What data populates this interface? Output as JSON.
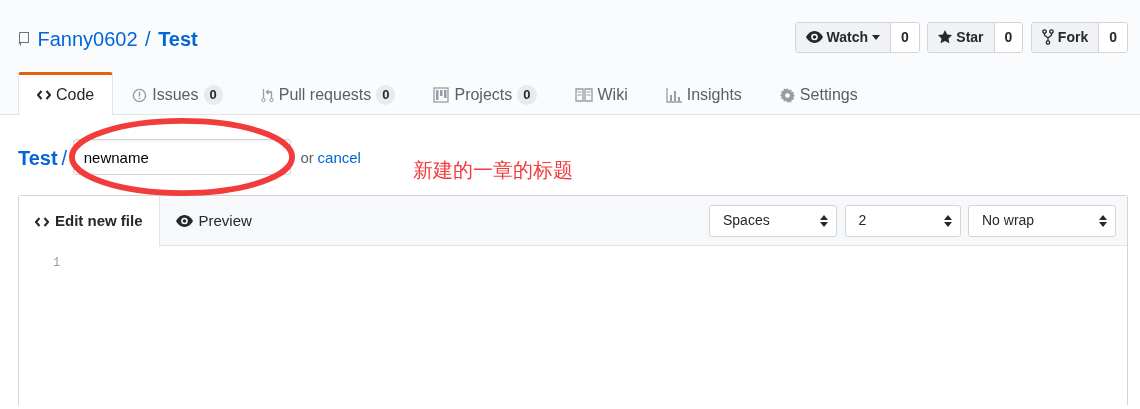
{
  "repo": {
    "owner": "Fanny0602",
    "separator": "/",
    "name": "Test"
  },
  "actions": [
    {
      "kind": "watch",
      "label": "Watch",
      "count": "0"
    },
    {
      "kind": "star",
      "label": "Star",
      "count": "0"
    },
    {
      "kind": "fork",
      "label": "Fork",
      "count": "0"
    }
  ],
  "tabs": [
    {
      "kind": "code",
      "label": "Code",
      "selected": true
    },
    {
      "kind": "issues",
      "label": "Issues",
      "count": "0",
      "selected": false
    },
    {
      "kind": "pulls",
      "label": "Pull requests",
      "count": "0",
      "selected": false
    },
    {
      "kind": "projects",
      "label": "Projects",
      "count": "0",
      "selected": false
    },
    {
      "kind": "wiki",
      "label": "Wiki",
      "selected": false
    },
    {
      "kind": "insights",
      "label": "Insights",
      "selected": false
    },
    {
      "kind": "settings",
      "label": "Settings",
      "selected": false
    }
  ],
  "path": {
    "repo": "Test",
    "separator": "/",
    "filename": "newname",
    "or": "or",
    "cancel": "cancel"
  },
  "annotation": "新建的一章的标题",
  "editor": {
    "tabs": [
      {
        "kind": "code",
        "label": "Edit new file",
        "selected": true
      },
      {
        "kind": "preview",
        "label": "Preview",
        "selected": false
      }
    ],
    "selects": [
      {
        "kind": "indent-mode",
        "value": "Spaces"
      },
      {
        "kind": "indent-size",
        "value": "2"
      },
      {
        "kind": "wrap-mode",
        "value": "No wrap"
      }
    ],
    "line_numbers": [
      "1"
    ]
  }
}
